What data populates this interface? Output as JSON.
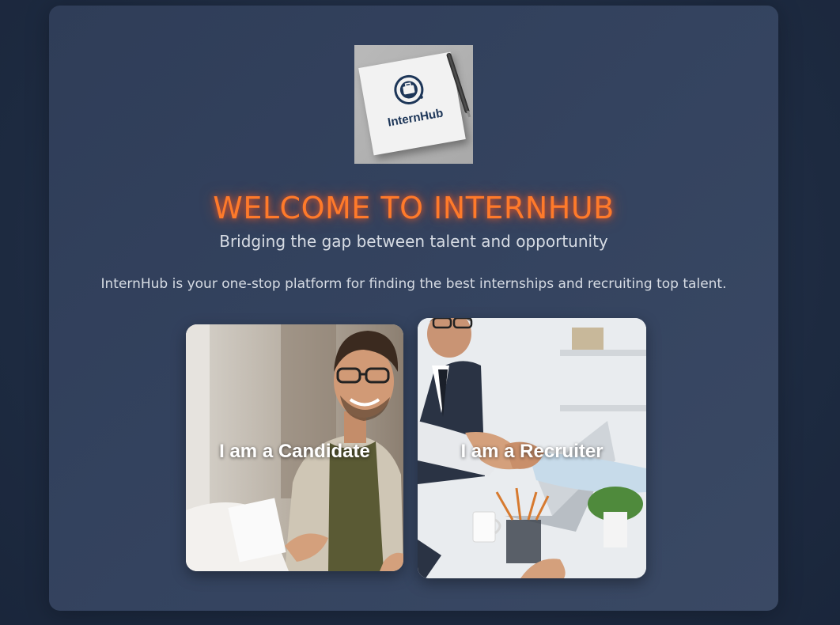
{
  "logo": {
    "text": "InternHub",
    "icon": "internhub-logo-icon"
  },
  "hero": {
    "title": "WELCOME TO INTERNHUB",
    "subtitle": "Bridging the gap between talent and opportunity",
    "description": "InternHub is your one-stop platform for finding the best internships and recruiting top talent."
  },
  "cards": {
    "candidate": {
      "label": "I am a Candidate"
    },
    "recruiter": {
      "label": "I am a Recruiter"
    }
  },
  "colors": {
    "title": "#ff7a2a",
    "panel": "#34435f",
    "background": "#1f2d44"
  }
}
